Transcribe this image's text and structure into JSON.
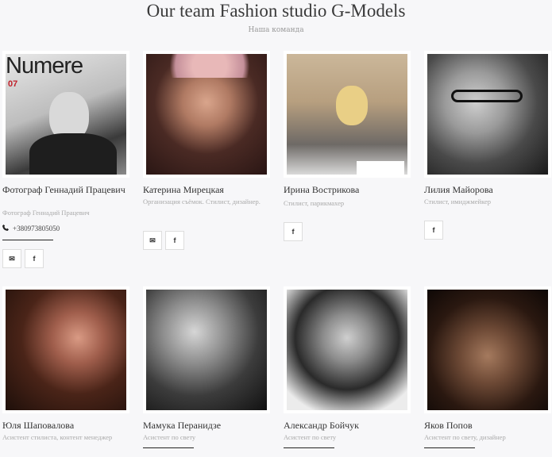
{
  "header": {
    "title": "Our team Fashion studio G-Models",
    "subtitle": "Наша команда"
  },
  "team": [
    {
      "name": "Фотограф Геннадий Працевич",
      "role": "Фотограф Геннадий Працевич",
      "phone": "+380973805050",
      "photo_text": "Numere",
      "photo_num": "07",
      "socials": [
        "✉",
        "f"
      ]
    },
    {
      "name": "Катерина Мирецкая",
      "role": "Организация съёмок. Стилист, дизайнер.",
      "socials": [
        "✉",
        "f"
      ]
    },
    {
      "name": "Ирина Вострикова",
      "role": "Стилист, парикмахер",
      "socials": [
        "f"
      ]
    },
    {
      "name": "Лилия Майорова",
      "role": "Стилист, имиджмейкер",
      "socials": [
        "f"
      ]
    },
    {
      "name": "Юля Шаповалова",
      "role": "Асистент стилиста, контент менеджер"
    },
    {
      "name": "Мамука Перанидзе",
      "role": "Асистент по свету"
    },
    {
      "name": "Александр Бойчук",
      "role": "Асистент по свету"
    },
    {
      "name": "Яков Попов",
      "role": "Асистент по свету, дизайнер"
    }
  ],
  "icons": {
    "phone": "phone-icon",
    "mail": "mail-icon",
    "facebook": "facebook-icon"
  }
}
